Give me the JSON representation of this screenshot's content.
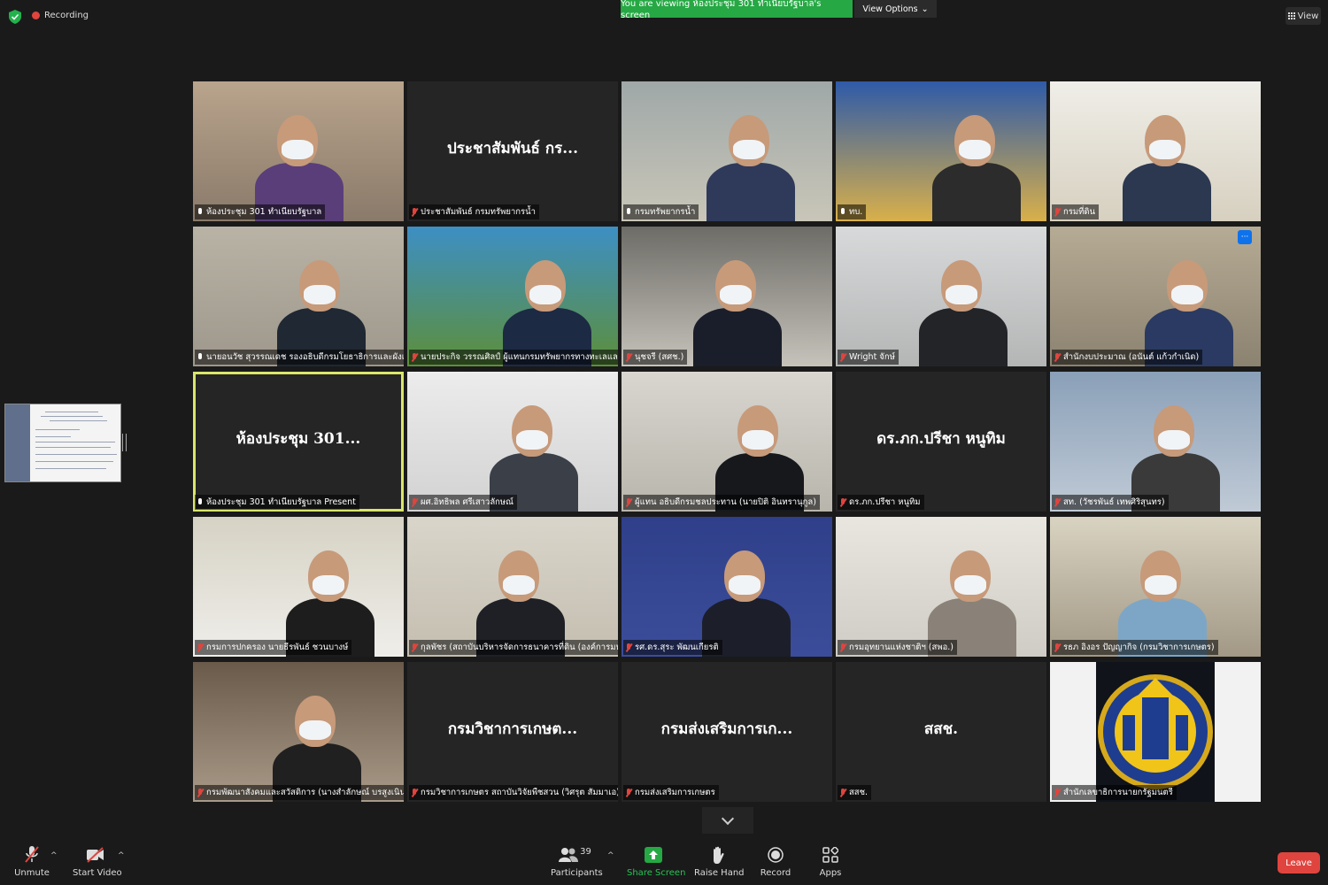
{
  "top": {
    "recording_label": "Recording",
    "viewing_banner": "You are viewing ห้องประชุม 301 ทำเนียบรัฐบาล's screen",
    "view_options_label": "View Options",
    "view_label": "View"
  },
  "tiles": [
    {
      "name": "ห้องประชุม 301 ทำเนียบรัฐบาล",
      "video": true,
      "muted": false
    },
    {
      "name": "ประชาสัมพันธ์ กรมทรัพยากรน้ำ",
      "video": false,
      "display_name": "ประชาสัมพันธ์ กร...",
      "muted": true
    },
    {
      "name": "กรมทรัพยากรน้ำ",
      "video": true,
      "muted": false
    },
    {
      "name": "ทบ.",
      "video": true,
      "muted": false
    },
    {
      "name": "กรมที่ดิน",
      "video": true,
      "muted": true
    },
    {
      "name": "นายอนวัช สุวรรณเดช รองอธิบดีกรมโยธาธิการและผังเมือง",
      "video": true,
      "muted": false
    },
    {
      "name": "นายประกิจ วรรณศิลป์ ผู้แทนกรมทรัพยากรทางทะเลและ...",
      "video": true,
      "muted": true
    },
    {
      "name": "นุชจรี (สศช.)",
      "video": true,
      "muted": true
    },
    {
      "name": "Wright จักษ์",
      "video": true,
      "muted": true
    },
    {
      "name": "สำนักงบประมาณ (อนันต์ แก้วกำเนิด)",
      "video": true,
      "muted": true,
      "has_more": true
    },
    {
      "name": "ห้องประชุม 301 ทำเนียบรัฐบาล Present",
      "video": false,
      "display_name": "ห้องประชุม 301...",
      "muted": false,
      "active": true
    },
    {
      "name": "ผศ.อิทธิพล ศรีเสาวลักษณ์",
      "video": true,
      "muted": true
    },
    {
      "name": "ผู้แทน อธิบดีกรมชลประทาน (นายปิติ อินทรานุกูล)",
      "video": true,
      "muted": true
    },
    {
      "name": "ดร.ภก.ปรีชา หนูทิม",
      "video": false,
      "display_name": "ดร.ภก.ปรีชา หนูทิม",
      "muted": true
    },
    {
      "name": "สท. (วัชรพันธ์ เทพศิริสุนทร)",
      "video": true,
      "muted": true
    },
    {
      "name": "กรมการปกครอง นายธีรพันธ์ ชวนบางษ์",
      "video": true,
      "muted": true
    },
    {
      "name": "กุลพัชร (สถาบันบริหารจัดการธนาคารที่ดิน (องค์การมห...",
      "video": true,
      "muted": true
    },
    {
      "name": "รศ.ดร.สุระ พัฒนเกียรติ",
      "video": true,
      "muted": true
    },
    {
      "name": "กรมอุทยานแห่งชาติฯ (สพอ.)",
      "video": true,
      "muted": true
    },
    {
      "name": "รธภ อิงอร ปัญญากิจ (กรมวิชาการเกษตร)",
      "video": true,
      "muted": true
    },
    {
      "name": "กรมพัฒนาสังคมและสวัสดิการ (นางสำลักษณ์ บรสูงเนิน)",
      "video": true,
      "muted": true
    },
    {
      "name": "กรมวิชาการเกษตร สถาบันวิจัยพืชสวน (วิศรุต สัมมาเอ)",
      "video": false,
      "display_name": "กรมวิชาการเกษต...",
      "muted": true
    },
    {
      "name": "กรมส่งเสริมการเกษตร",
      "video": false,
      "display_name": "กรมส่งเสริมการเก...",
      "muted": true
    },
    {
      "name": "สสช.",
      "video": false,
      "display_name": "สสช.",
      "muted": true
    },
    {
      "name": "สำนักเลขาธิการนายกรัฐมนตรี",
      "video": true,
      "muted": true,
      "emblem": true
    }
  ],
  "toolbar": {
    "unmute": "Unmute",
    "start_video": "Start Video",
    "participants": "Participants",
    "participant_count": "39",
    "share_screen": "Share Screen",
    "raise_hand": "Raise Hand",
    "record": "Record",
    "apps": "Apps",
    "leave": "Leave"
  },
  "colors": {
    "accent_green": "#26a844",
    "leave_red": "#e0443e",
    "active_border": "#d9e66a"
  }
}
